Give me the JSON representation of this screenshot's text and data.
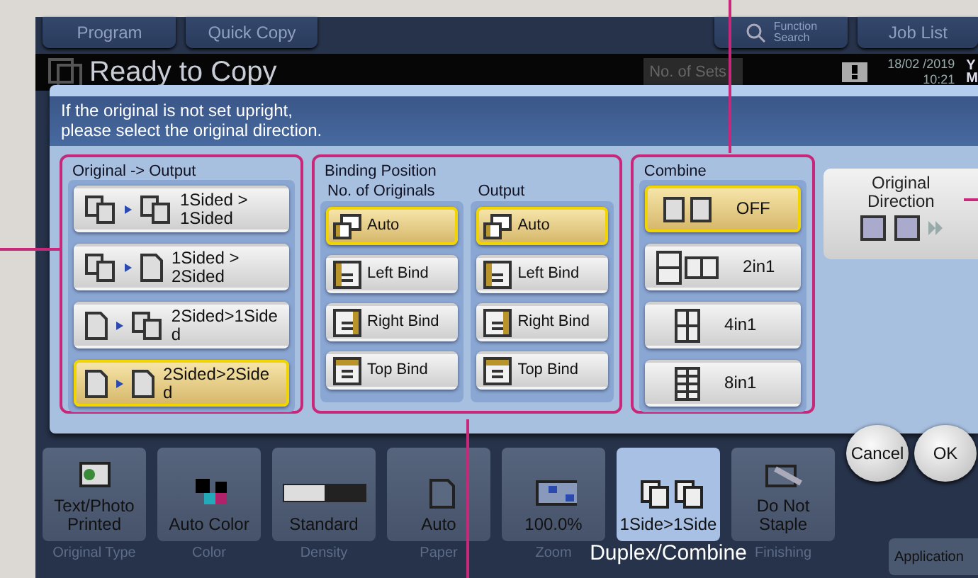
{
  "top_tabs": [
    {
      "label": "Program",
      "kind": "plain"
    },
    {
      "label": "Quick Copy",
      "kind": "plain"
    },
    {
      "label": "Function Search",
      "kind": "search"
    },
    {
      "label": "Job List",
      "kind": "plain"
    }
  ],
  "status_bar": {
    "title": "Ready to Copy",
    "sets_label": "No. of Sets",
    "date": "18/02 /2019",
    "time": "10:21",
    "toner": [
      "Y",
      "M"
    ]
  },
  "dialog": {
    "message": "If the original is not set upright,\nplease select the original direction.",
    "original_output": {
      "title": "Original -> Output",
      "options": [
        {
          "label": "1Sided >\n1Sided",
          "selected": false
        },
        {
          "label": "1Sided >\n2Sided",
          "selected": false
        },
        {
          "label": "2Sided>1Side\nd",
          "selected": false
        },
        {
          "label": "2Sided>2Side\nd",
          "selected": true
        }
      ]
    },
    "binding": {
      "title": "Binding Position",
      "columns": [
        {
          "title": "No. of Originals",
          "options": [
            {
              "label": "Auto",
              "selected": true
            },
            {
              "label": "Left Bind",
              "selected": false
            },
            {
              "label": "Right Bind",
              "selected": false
            },
            {
              "label": "Top Bind",
              "selected": false
            }
          ]
        },
        {
          "title": "Output",
          "options": [
            {
              "label": "Auto",
              "selected": true
            },
            {
              "label": "Left Bind",
              "selected": false
            },
            {
              "label": "Right Bind",
              "selected": false
            },
            {
              "label": "Top Bind",
              "selected": false
            }
          ]
        }
      ]
    },
    "combine": {
      "title": "Combine",
      "options": [
        {
          "label": "OFF",
          "selected": true
        },
        {
          "label": "2in1",
          "selected": false
        },
        {
          "label": "4in1",
          "selected": false
        },
        {
          "label": "8in1",
          "selected": false
        }
      ]
    },
    "original_direction": {
      "label": "Original\nDirection"
    },
    "buttons": [
      "Cancel",
      "OK"
    ]
  },
  "function_keys": [
    {
      "value": "Text/Photo\nPrinted",
      "caption": "Original Type",
      "selected": false
    },
    {
      "value": "Auto Color",
      "caption": "Color",
      "selected": false
    },
    {
      "value": "Standard",
      "caption": "Density",
      "selected": false
    },
    {
      "value": "Auto",
      "caption": "Paper",
      "selected": false
    },
    {
      "value": "100.0%",
      "caption": "Zoom",
      "selected": false
    },
    {
      "value": "1Side>1Side",
      "caption": "Duplex/Combine",
      "selected": true
    },
    {
      "value": "Do Not\nStaple",
      "caption": "Finishing",
      "selected": false
    }
  ],
  "application_button": "Application"
}
